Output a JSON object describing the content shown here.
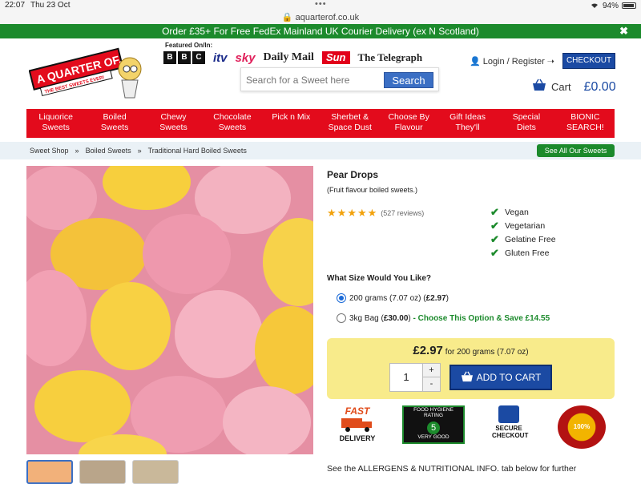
{
  "status": {
    "time": "22:07",
    "date": "Thu 23 Oct",
    "battery": "94%"
  },
  "url": {
    "host": "aquarterof.co.uk"
  },
  "promo": {
    "text": "Order £35+ For Free FedEx Mainland UK Courier Delivery (ex N Scotland)",
    "close": "✖"
  },
  "header": {
    "logo_text": "A QUARTER OF...",
    "logo_tagline": "THE BEST SWEETS EVER!",
    "featured_label": "Featured On/In:",
    "media": {
      "bbc": [
        "B",
        "B",
        "C"
      ],
      "itv": "itv",
      "sky": "sky",
      "daily_mail": "Daily Mail",
      "sun": "Sun",
      "telegraph": "The Telegraph"
    },
    "login": "Login / Register",
    "checkout": "CHECKOUT",
    "cart_label": "Cart",
    "cart_total": "£0.00"
  },
  "search": {
    "placeholder": "Search for a Sweet here",
    "button": "Search"
  },
  "nav": [
    {
      "line1": "Liquorice",
      "line2": "Sweets"
    },
    {
      "line1": "Boiled",
      "line2": "Sweets"
    },
    {
      "line1": "Chewy",
      "line2": "Sweets"
    },
    {
      "line1": "Chocolate",
      "line2": "Sweets"
    },
    {
      "line1": "Pick n Mix",
      "line2": ""
    },
    {
      "line1": "Sherbet &",
      "line2": "Space Dust"
    },
    {
      "line1": "Choose By",
      "line2": "Flavour"
    },
    {
      "line1": "Gift Ideas",
      "line2": "They'll"
    },
    {
      "line1": "Special",
      "line2": "Diets"
    },
    {
      "line1": "BIONIC",
      "line2": "SEARCH!"
    }
  ],
  "breadcrumb": {
    "items": [
      "Sweet Shop",
      "»",
      "Boiled Sweets",
      "»",
      "Traditional Hard Boiled Sweets"
    ],
    "see_all": "See All Our Sweets"
  },
  "product": {
    "title": "Pear Drops",
    "subtitle": "(Fruit flavour boiled sweets.)",
    "rating": 4.5,
    "reviews": "(527 reviews)",
    "diet": [
      "Vegan",
      "Vegetarian",
      "Gelatine Free",
      "Gluten Free"
    ],
    "size_question": "What Size Would You Like?",
    "options": [
      {
        "text": "200 grams (7.07 oz) (",
        "price": "£2.97",
        "close": ")",
        "selected": true,
        "extra": ""
      },
      {
        "text": "3kg Bag (",
        "price": "£30.00",
        "close": ")",
        "selected": false,
        "extra": " - Choose This Option & Save £14.55"
      }
    ],
    "price": "£2.97",
    "price_suffix": "for 200 grams (7.07 oz)",
    "quantity": "1",
    "qty_plus": "+",
    "qty_minus": "-",
    "add_to_cart": "ADD TO CART"
  },
  "badges": {
    "fast_top": "FAST",
    "fast_bottom": "DELIVERY",
    "hygiene": "FOOD HYGIENE RATING",
    "hygiene_score": "5",
    "hygiene_sub": "VERY GOOD",
    "secure_1": "SECURE",
    "secure_2": "CHECKOUT",
    "guarantee": "100%"
  },
  "bottom_text": "See the ALLERGENS & NUTRITIONAL INFO. tab below for further"
}
